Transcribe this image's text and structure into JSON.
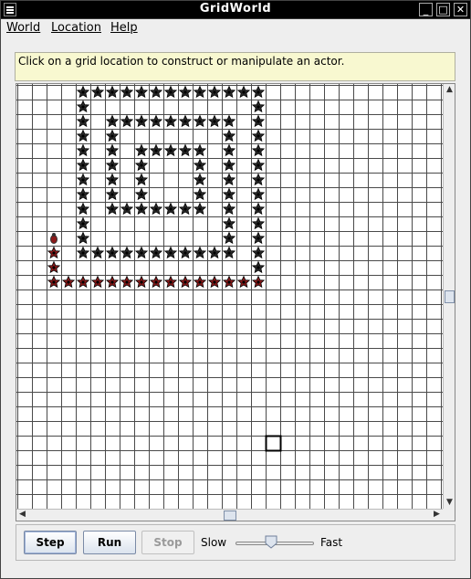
{
  "window": {
    "title": "GridWorld"
  },
  "menubar": {
    "items": [
      "World",
      "Location",
      "Help"
    ]
  },
  "message": "Click on a grid location to construct or manipulate an actor.",
  "grid": {
    "selected_cell": {
      "row": 24,
      "col": 17
    },
    "actors": [
      {
        "type": "bug",
        "color": "#8b1a1a",
        "cells": [
          [
            10,
            2
          ]
        ]
      },
      {
        "type": "flower",
        "color": "#8b1a1a",
        "cells": [
          [
            11,
            2
          ],
          [
            12,
            2
          ],
          [
            13,
            2
          ],
          [
            13,
            3
          ],
          [
            13,
            4
          ],
          [
            13,
            5
          ],
          [
            13,
            6
          ],
          [
            13,
            7
          ],
          [
            13,
            8
          ],
          [
            13,
            9
          ],
          [
            13,
            10
          ],
          [
            13,
            11
          ],
          [
            13,
            12
          ],
          [
            13,
            13
          ],
          [
            13,
            14
          ],
          [
            13,
            15
          ],
          [
            13,
            16
          ]
        ]
      },
      {
        "type": "flower",
        "color": "#2a2a2a",
        "cells": [
          [
            0,
            4
          ],
          [
            0,
            5
          ],
          [
            0,
            6
          ],
          [
            0,
            7
          ],
          [
            0,
            8
          ],
          [
            0,
            9
          ],
          [
            0,
            10
          ],
          [
            0,
            11
          ],
          [
            0,
            12
          ],
          [
            0,
            13
          ],
          [
            0,
            14
          ],
          [
            0,
            15
          ],
          [
            0,
            16
          ],
          [
            1,
            4
          ],
          [
            1,
            16
          ],
          [
            2,
            4
          ],
          [
            2,
            6
          ],
          [
            2,
            7
          ],
          [
            2,
            8
          ],
          [
            2,
            9
          ],
          [
            2,
            10
          ],
          [
            2,
            11
          ],
          [
            2,
            12
          ],
          [
            2,
            13
          ],
          [
            2,
            14
          ],
          [
            2,
            16
          ],
          [
            3,
            4
          ],
          [
            3,
            6
          ],
          [
            3,
            14
          ],
          [
            3,
            16
          ],
          [
            4,
            4
          ],
          [
            4,
            6
          ],
          [
            4,
            8
          ],
          [
            4,
            9
          ],
          [
            4,
            10
          ],
          [
            4,
            11
          ],
          [
            4,
            12
          ],
          [
            4,
            14
          ],
          [
            4,
            16
          ],
          [
            5,
            4
          ],
          [
            5,
            6
          ],
          [
            5,
            8
          ],
          [
            5,
            12
          ],
          [
            5,
            14
          ],
          [
            5,
            16
          ],
          [
            6,
            4
          ],
          [
            6,
            6
          ],
          [
            6,
            8
          ],
          [
            6,
            12
          ],
          [
            6,
            14
          ],
          [
            6,
            16
          ],
          [
            7,
            4
          ],
          [
            7,
            6
          ],
          [
            7,
            8
          ],
          [
            7,
            12
          ],
          [
            7,
            14
          ],
          [
            7,
            16
          ],
          [
            8,
            4
          ],
          [
            8,
            6
          ],
          [
            8,
            7
          ],
          [
            8,
            8
          ],
          [
            8,
            9
          ],
          [
            8,
            10
          ],
          [
            8,
            11
          ],
          [
            8,
            12
          ],
          [
            8,
            14
          ],
          [
            8,
            16
          ],
          [
            9,
            4
          ],
          [
            9,
            14
          ],
          [
            9,
            16
          ],
          [
            10,
            4
          ],
          [
            10,
            14
          ],
          [
            10,
            16
          ],
          [
            11,
            4
          ],
          [
            11,
            5
          ],
          [
            11,
            6
          ],
          [
            11,
            7
          ],
          [
            11,
            8
          ],
          [
            11,
            9
          ],
          [
            11,
            10
          ],
          [
            11,
            11
          ],
          [
            11,
            12
          ],
          [
            11,
            13
          ],
          [
            11,
            14
          ],
          [
            11,
            16
          ],
          [
            12,
            16
          ]
        ]
      }
    ]
  },
  "scroll": {
    "vertical_fraction": 0.5,
    "horizontal_fraction": 0.5
  },
  "controls": {
    "step_label": "Step",
    "run_label": "Run",
    "stop_label": "Stop",
    "slow_label": "Slow",
    "fast_label": "Fast",
    "speed_fraction": 0.45
  }
}
